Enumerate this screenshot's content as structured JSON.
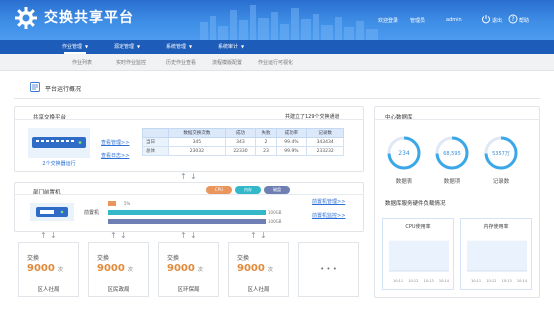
{
  "header": {
    "title": "交换共享平台",
    "user_links": [
      "欢迎登录",
      "管理员",
      "admin"
    ],
    "logout": "退出",
    "help": "帮助"
  },
  "nav": {
    "items": [
      {
        "label": "作业管理",
        "icon": "chevron-down-icon"
      },
      {
        "label": "源定管理",
        "icon": "chevron-down-icon"
      },
      {
        "label": "系统管理",
        "icon": "chevron-down-icon"
      },
      {
        "label": "系统审计",
        "icon": "chevron-down-icon"
      }
    ],
    "sub_items": [
      "作业列表",
      "实时作业监控",
      "历史作业查看",
      "流程模版配置",
      "作业运行可视化"
    ]
  },
  "section_title": "平台运行概况",
  "exchange": {
    "title": "共享交换平台",
    "summary": "共建立了129个交换通道",
    "switch_label": "2个交换器运行",
    "links": [
      "查看管理>>",
      "查看日志>>"
    ],
    "table": {
      "headers": [
        "",
        "数据交换次数",
        "成功",
        "失败",
        "成功率",
        "记录数"
      ],
      "rows": [
        [
          "当日",
          "345",
          "343",
          "2",
          "99.4%",
          "343434"
        ],
        [
          "总体",
          "23032",
          "22330",
          "23",
          "99.9%",
          "233232"
        ]
      ]
    }
  },
  "front": {
    "title": "部门前置机",
    "device_label": "前置机",
    "links": [
      "前置机管理>>",
      "前置机监控>>"
    ],
    "legend": [
      "CPU",
      "内存",
      "磁盘"
    ],
    "bars": [
      {
        "value": 5,
        "label": "5%"
      },
      {
        "value": 100,
        "label": "100GB"
      },
      {
        "value": 100,
        "label": "100GB"
      }
    ]
  },
  "nodes": [
    {
      "label": "交换",
      "count": "9000",
      "unit": "次",
      "name": "区人社局"
    },
    {
      "label": "交换",
      "count": "9000",
      "unit": "次",
      "name": "区民政局"
    },
    {
      "label": "交换",
      "count": "9000",
      "unit": "次",
      "name": "区环保局"
    },
    {
      "label": "交换",
      "count": "9000",
      "unit": "次",
      "name": "区人社局"
    }
  ],
  "more": "• • •",
  "db": {
    "title": "中心数据库",
    "stats": [
      {
        "value": "234",
        "label": "数据表"
      },
      {
        "value": "68,595",
        "label": "数据项"
      },
      {
        "value": "5357万",
        "label": "记录数"
      }
    ],
    "load_title": "数据库服务硬件负载情况",
    "charts": [
      {
        "title": "CPU使用率",
        "x_ticks": [
          "10:11",
          "10:12",
          "10:13",
          "10:14"
        ]
      },
      {
        "title": "内存使用率",
        "x_ticks": [
          "10:11",
          "10:12",
          "10:13",
          "10:14"
        ]
      }
    ]
  },
  "colors": {
    "header": "#2f7bdc",
    "nav": "#1d5cb8",
    "accent": "#3aa7e8",
    "orange": "#e9955b",
    "teal": "#33b8c9",
    "purple": "#6f7fb4"
  }
}
